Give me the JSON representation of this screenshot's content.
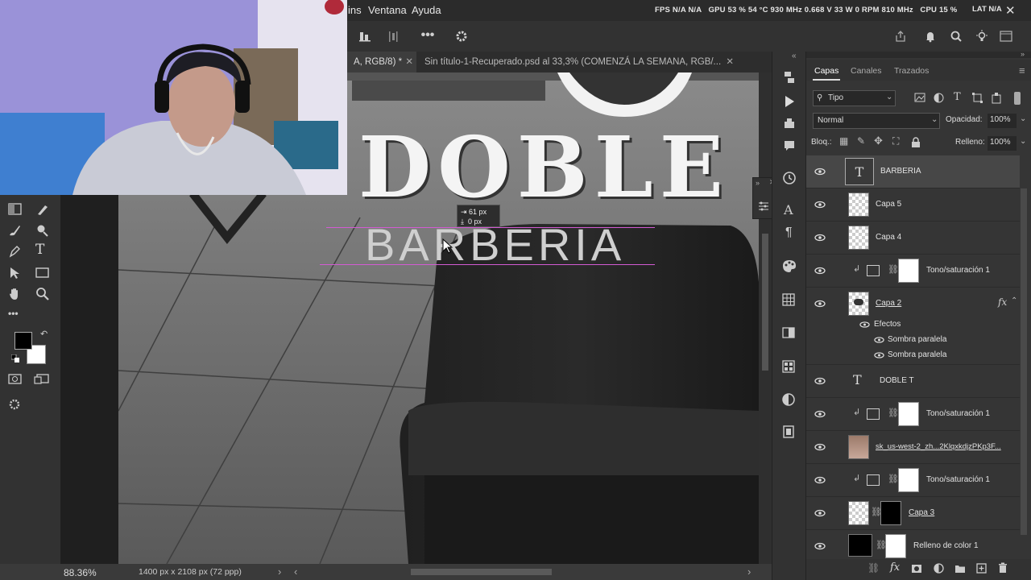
{
  "menu": {
    "items": [
      "ins",
      "Ventana",
      "Ayuda"
    ]
  },
  "performance": {
    "fps_label": "FPS",
    "fps_value1": "N/A",
    "fps_value2": "N/A",
    "gpu_label": "GPU",
    "gpu_values": "53 % 54 °C 930 MHz 0.668 V 33 W 0 RPM 810 MHz",
    "cpu_label": "CPU",
    "cpu_value": "15 %",
    "lat_label": "LAT",
    "lat_value": "N/A"
  },
  "tabs": [
    {
      "label": "A, RGB/8) *",
      "active": true
    },
    {
      "label": "Sin título-1-Recuperado.psd al 33,3% (COMENZÁ LA SEMANA, RGB/...",
      "active": false
    }
  ],
  "canvas": {
    "title_text": "DOBLE",
    "subtitle_text": "BARBERIA",
    "tooltip_line1": "61 px",
    "tooltip_line2": "0 px"
  },
  "status": {
    "zoom": "88.36%",
    "doc_size": "1400 px x 2108 px (72 ppp)"
  },
  "panel": {
    "tabs": [
      "Capas",
      "Canales",
      "Trazados"
    ],
    "filter_label": "Tipo",
    "blend_mode": "Normal",
    "opacity_label": "Opacidad:",
    "opacity_value": "100%",
    "lock_label": "Bloq.:",
    "fill_label": "Relleno:",
    "fill_value": "100%",
    "effects_label": "Efectos",
    "effect_items": [
      "Sombra paralela",
      "Sombra paralela"
    ],
    "layers": [
      {
        "name": "BARBERIA",
        "kind": "text",
        "selected": true
      },
      {
        "name": "Capa 5",
        "kind": "pixel"
      },
      {
        "name": "Capa 4",
        "kind": "pixel"
      },
      {
        "name": "Tono/saturación 1",
        "kind": "adjustment"
      },
      {
        "name": "Capa 2",
        "kind": "pixel"
      },
      {
        "name": "DOBLE T",
        "kind": "text"
      },
      {
        "name": "Tono/saturación 1",
        "kind": "adjustment"
      },
      {
        "name": "sk_us-west-2_zh...2KlqxkdjzPKp3F...",
        "kind": "smart"
      },
      {
        "name": "Tono/saturación 1",
        "kind": "adjustment"
      },
      {
        "name": "Capa 3",
        "kind": "masked"
      },
      {
        "name": "Relleno de color 1",
        "kind": "fill"
      }
    ]
  },
  "colors": {
    "accent_guide": "#d35bd3",
    "panel_bg": "#353535",
    "selected_layer": "#474747"
  }
}
